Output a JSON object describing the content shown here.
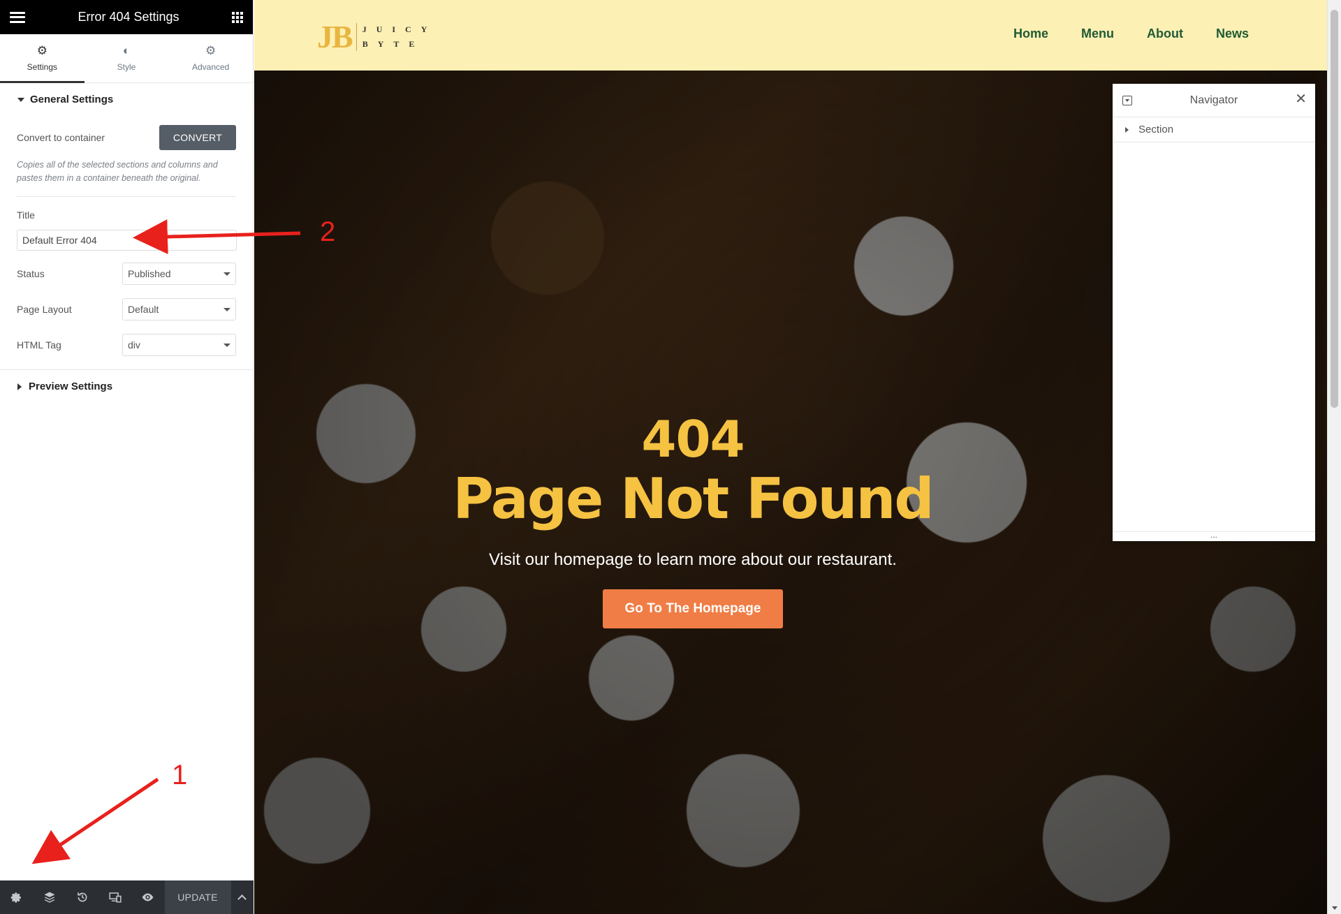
{
  "panel": {
    "title": "Error 404 Settings",
    "tabs": [
      {
        "label": "Settings",
        "icon": "gear-icon"
      },
      {
        "label": "Style",
        "icon": "half-circle-icon"
      },
      {
        "label": "Advanced",
        "icon": "cog-icon"
      }
    ],
    "general_settings": {
      "heading": "General Settings",
      "convert_label": "Convert to container",
      "convert_button": "CONVERT",
      "convert_desc": "Copies all of the selected sections and columns and pastes them in a container beneath the original.",
      "title_label": "Title",
      "title_value": "Default Error 404",
      "status_label": "Status",
      "status_value": "Published",
      "layout_label": "Page Layout",
      "layout_value": "Default",
      "html_tag_label": "HTML Tag",
      "html_tag_value": "div"
    },
    "preview_settings": {
      "heading": "Preview Settings"
    },
    "footer": {
      "icons": [
        "gear-icon",
        "layers-icon",
        "history-icon",
        "responsive-icon",
        "eye-icon"
      ],
      "update_label": "UPDATE"
    }
  },
  "site": {
    "logo": {
      "initials": "JB",
      "line1": "JUICY",
      "line2": "BYTE",
      "color": "#e8b53f"
    },
    "nav": [
      "Home",
      "Menu",
      "About",
      "News"
    ],
    "header_bg": "#fdf0b4",
    "nav_color": "#1f5a35"
  },
  "hero": {
    "code": "404",
    "title": "Page Not Found",
    "subtitle": "Visit our homepage to learn more about our restaurant.",
    "button": "Go To The Homepage",
    "title_color": "#f5c242",
    "button_color": "#f07d45"
  },
  "navigator": {
    "title": "Navigator",
    "items": [
      "Section"
    ],
    "footer": "..."
  },
  "annotations": {
    "labels": [
      "1",
      "2"
    ],
    "color": "#e8211c"
  }
}
